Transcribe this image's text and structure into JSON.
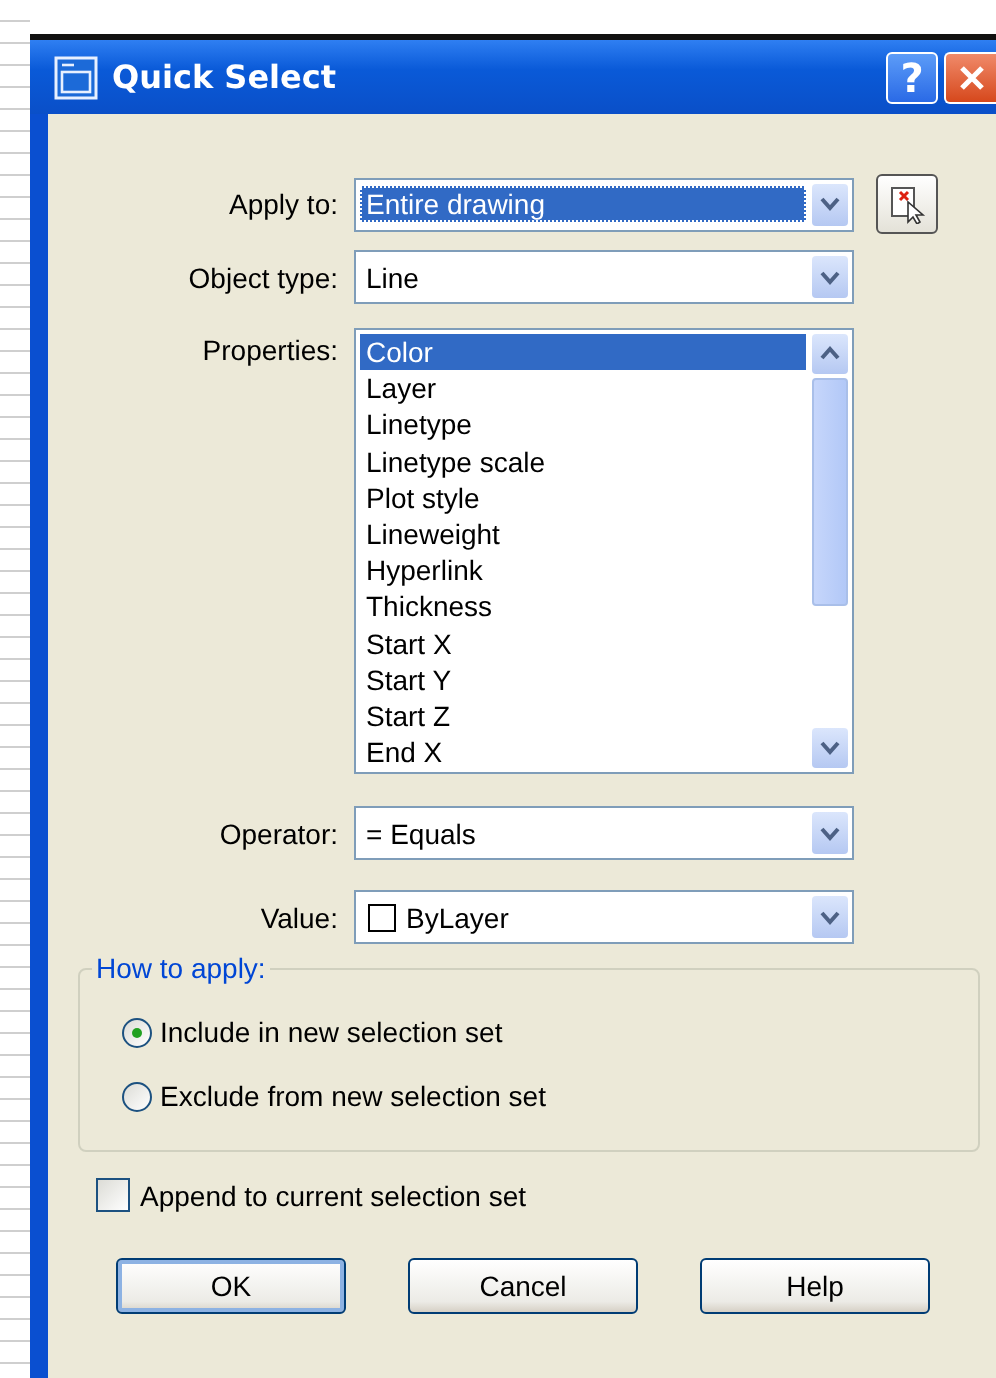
{
  "window": {
    "title": "Quick Select",
    "buttons": [
      {
        "kind": "help",
        "label": "?"
      },
      {
        "kind": "close"
      }
    ]
  },
  "apply_to": {
    "label": "Apply to:",
    "value": "Entire drawing",
    "focused": true
  },
  "object_type": {
    "label": "Object type:",
    "value": "Line"
  },
  "properties": {
    "label": "Properties:",
    "items": [
      {
        "label": "Color",
        "selected": true
      },
      {
        "label": "Layer",
        "selected": false
      },
      {
        "label": "Linetype",
        "selected": false
      },
      {
        "label": "Linetype scale",
        "selected": false
      },
      {
        "label": "Plot style",
        "selected": false
      },
      {
        "label": "Lineweight",
        "selected": false
      },
      {
        "label": "Hyperlink",
        "selected": false
      },
      {
        "label": "Thickness",
        "selected": false
      },
      {
        "label": "Start X",
        "selected": false
      },
      {
        "label": "Start Y",
        "selected": false
      },
      {
        "label": "Start Z",
        "selected": false
      },
      {
        "label": "End X",
        "selected": false
      }
    ]
  },
  "operator": {
    "label": "Operator:",
    "value": "= Equals"
  },
  "value": {
    "label": "Value:",
    "value": "ByLayer",
    "swatch": true
  },
  "how_to_apply": {
    "title": "How to apply:",
    "options": [
      {
        "label": "Include in new selection set",
        "selected": true
      },
      {
        "label": "Exclude from new selection set",
        "selected": false
      }
    ]
  },
  "append": {
    "label": "Append to current selection set",
    "checked": false
  },
  "buttons": [
    {
      "label": "OK",
      "default": true
    },
    {
      "label": "Cancel",
      "default": false
    },
    {
      "label": "Help",
      "default": false
    }
  ]
}
